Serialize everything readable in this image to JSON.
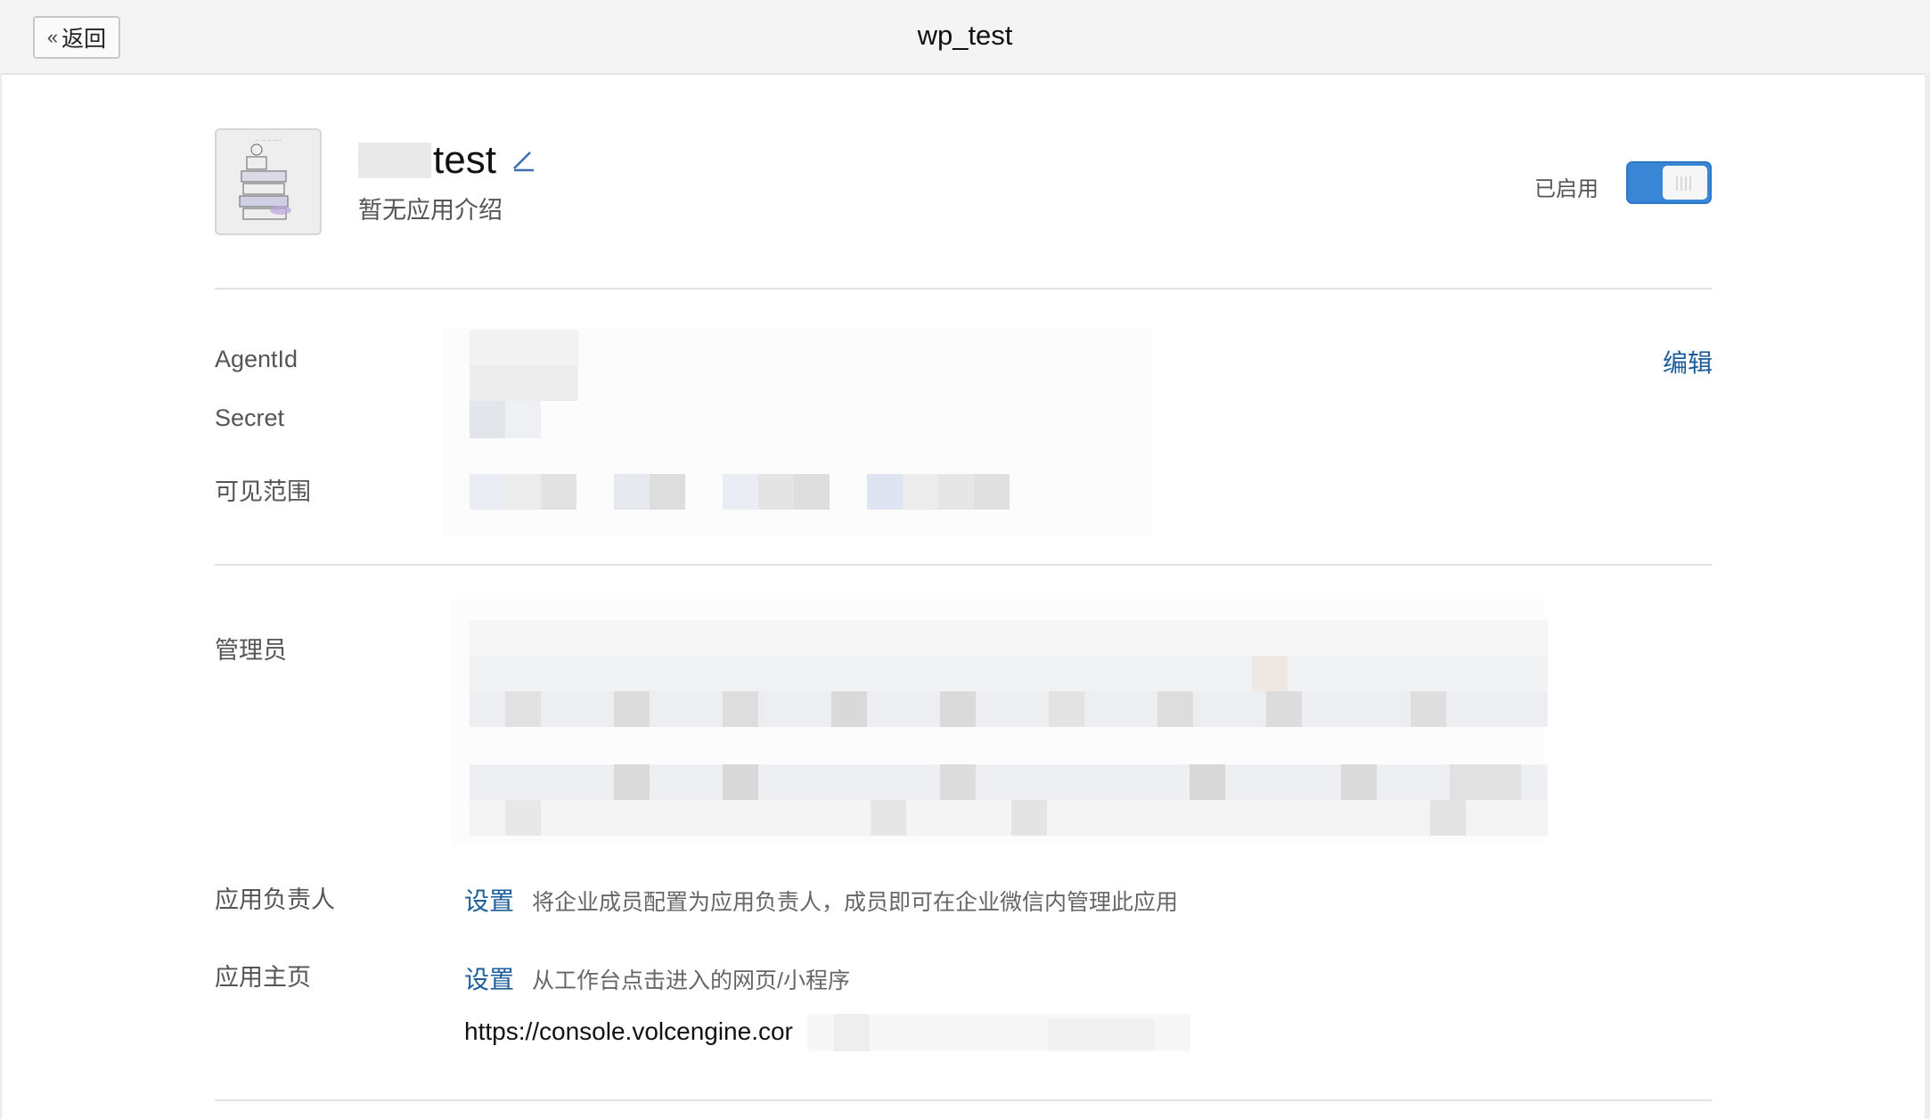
{
  "header": {
    "back_label": "返回",
    "title": "wp_test"
  },
  "app": {
    "name_suffix": "test",
    "intro": "暂无应用介绍",
    "status_label": "已启用",
    "enabled": true
  },
  "credentials": {
    "agent_id_label": "AgentId",
    "secret_label": "Secret",
    "visibility_label": "可见范围",
    "edit_label": "编辑"
  },
  "admins": {
    "label": "管理员"
  },
  "owner": {
    "label": "应用负责人",
    "set_label": "设置",
    "description": "将企业成员配置为应用负责人，成员即可在企业微信内管理此应用"
  },
  "homepage": {
    "label": "应用主页",
    "set_label": "设置",
    "description": "从工作台点击进入的网页/小程序",
    "url_visible": "https://console.volcengine.cor"
  },
  "icons": {
    "back": "double-chevron-left-icon",
    "edit": "pencil-icon"
  },
  "colors": {
    "accent": "#3a86d6",
    "link": "#1c5d9b"
  }
}
